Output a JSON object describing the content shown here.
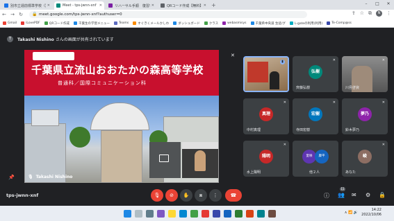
{
  "browser": {
    "tabs": [
      {
        "label": "別市立週前標準学校（別瑠島）",
        "color": "#1a73e8",
        "active": false
      },
      {
        "label": "Meet - tps-jwnn-xnf",
        "color": "#00897b",
        "active": true
      },
      {
        "label": "リハーサル手順　復習表 - Google",
        "color": "#7b1fa2",
        "active": false
      },
      {
        "label": "QRコード作成【無料】URLをQRコー",
        "color": "#5f6368",
        "active": false
      }
    ],
    "new_tab": "+",
    "url": "meet.google.com/tps-jwnn-xnf?authuser=0",
    "window_controls": [
      "–",
      "□",
      "✕"
    ]
  },
  "bookmarks": [
    {
      "label": "Gmail",
      "color": "#ea4335"
    },
    {
      "label": "iLovePDF",
      "color": "#e53935"
    },
    {
      "label": "QRコード作成",
      "color": "#43a047"
    },
    {
      "label": "千葉生の学習メニュー",
      "color": "#1e88e5"
    },
    {
      "label": "Teams",
      "color": "#5c6bc0"
    },
    {
      "label": "すぐきくメールかしわ",
      "color": "#fb8c00"
    },
    {
      "label": "ダッシュボード",
      "color": "#1e88e5"
    },
    {
      "label": "クラス",
      "color": "#43a047"
    },
    {
      "label": "webasmisys",
      "color": "#8e24aa"
    },
    {
      "label": "千葉県中央道 生徒/グ",
      "color": "#1e88e5"
    },
    {
      "label": "L-gateの利用(利用)",
      "color": "#00acc1"
    },
    {
      "label": "Te-Comp@ss",
      "color": "#3949ab"
    }
  ],
  "meet": {
    "presenter_initial": "T",
    "presenter_name": "Takashi Nishino",
    "presenting_text": "さんの画面が共有されています",
    "main_label": "Takashi Nishino",
    "banner_title": "千葉県立流山おおたかの森高等学校",
    "banner_subtitle": "普通科／国際コミュニケーション科",
    "meeting_code": "tps-jwnn-xnf",
    "participants": [
      {
        "name": "",
        "initial": "",
        "type": "video"
      },
      {
        "name": "齊藤弘樹",
        "initial": "弘樹",
        "color": "#00897b",
        "type": "avatar"
      },
      {
        "name": "川島啓資",
        "initial": "",
        "type": "video"
      },
      {
        "name": "中村真理",
        "initial": "真理",
        "color": "#c62828",
        "type": "avatar"
      },
      {
        "name": "寺田宏樹",
        "initial": "宏樹",
        "color": "#0277bd",
        "type": "avatar"
      },
      {
        "name": "鈴木夢乃",
        "initial": "夢乃",
        "color": "#8e24aa",
        "type": "avatar"
      },
      {
        "name": "水上陽明",
        "initial": "陽明",
        "color": "#c62828",
        "type": "avatar"
      },
      {
        "name": "他２人",
        "initial": "",
        "type": "group",
        "group_initials": [
          "愛咲",
          "康平"
        ]
      },
      {
        "name": "あなた",
        "initial": "峻",
        "color": "#8d6e63",
        "type": "avatar"
      }
    ],
    "participant_count": "11"
  },
  "taskbar": {
    "time": "14:22",
    "date": "2022/10/06"
  },
  "colors": {
    "accent": "#8ab4f8",
    "danger": "#ea4335",
    "banner": "#c8102e"
  }
}
